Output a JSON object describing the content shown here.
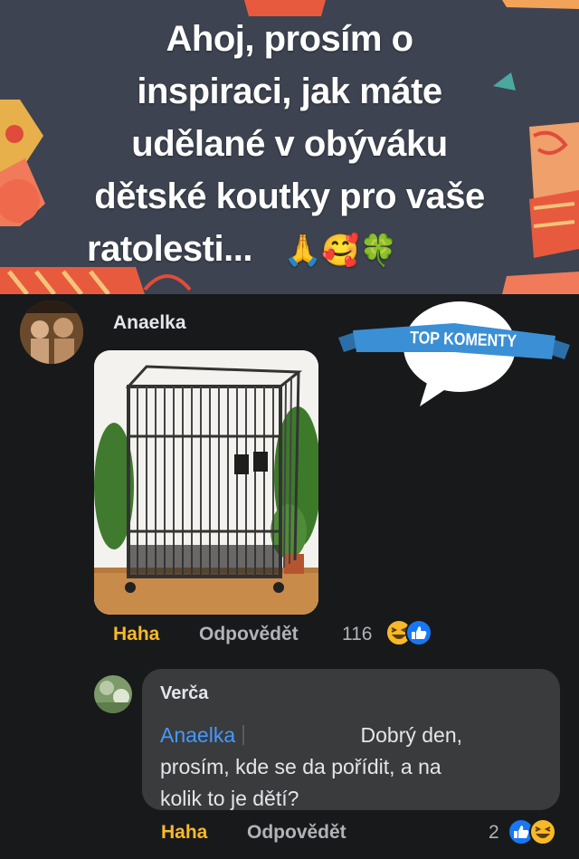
{
  "post": {
    "title_line1": "Ahoj, prosím o",
    "title_line2": "inspiraci, jak máte",
    "title_line3": "udělané v obýváku",
    "title_line4": "dětské koutky pro vaše",
    "title_line5": "ratolesti...",
    "title_emojis": "🙏🥰🍀",
    "background_color": "#3d4350"
  },
  "badge": {
    "label": "TOP KOMENTY",
    "ribbon_color": "#3b8fd4"
  },
  "comments": [
    {
      "author": "Anaelka",
      "image_description_icon": "parrot-cage-photo",
      "actions": {
        "haha": "Haha",
        "reply": "Odpovědět"
      },
      "reaction_count": "116",
      "reactions": [
        "haha-icon",
        "like-icon"
      ]
    }
  ],
  "reply": {
    "author": "Verča",
    "mention": "Anaelka",
    "text_line1": "Dobrý den,",
    "text_line2": "prosím, kde se da pořídit, a na",
    "text_line3": "kolik to je dětí?",
    "actions": {
      "haha": "Haha",
      "reply": "Odpovědět"
    },
    "reaction_count": "2",
    "reactions": [
      "like-icon",
      "haha-icon"
    ]
  },
  "colors": {
    "page_bg": "#18191a",
    "bubble_bg": "#3a3b3c",
    "haha": "#f7b928",
    "mention": "#4599ff",
    "like": "#1877f2"
  }
}
